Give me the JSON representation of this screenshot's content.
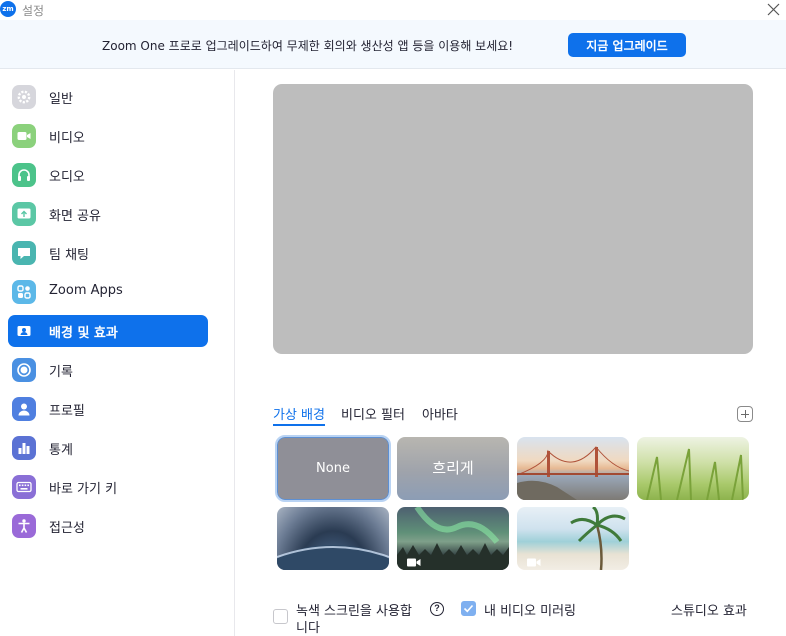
{
  "window": {
    "logo_text": "zm",
    "title": "설정"
  },
  "banner": {
    "text": "Zoom One 프로로 업그레이드하여 무제한 회의와 생산성 앱 등을 이용해 보세요!",
    "button_label": "지금 업그레이드"
  },
  "sidebar": {
    "items": [
      {
        "label": "일반",
        "icon": "gear-icon",
        "color": "#cfcfd6"
      },
      {
        "label": "비디오",
        "icon": "video-camera-icon",
        "color": "#8bd17c"
      },
      {
        "label": "오디오",
        "icon": "headphones-icon",
        "color": "#4cc38a"
      },
      {
        "label": "화면 공유",
        "icon": "screen-share-icon",
        "color": "#5bc7a5"
      },
      {
        "label": "팀 채팅",
        "icon": "chat-bubble-icon",
        "color": "#4ab5b0"
      },
      {
        "label": "Zoom Apps",
        "icon": "apps-icon",
        "color": "#5cb8e8"
      },
      {
        "label": "배경 및 효과",
        "icon": "portrait-icon",
        "color": "#0e71eb"
      },
      {
        "label": "기록",
        "icon": "record-icon",
        "color": "#4a90e2"
      },
      {
        "label": "프로필",
        "icon": "user-icon",
        "color": "#4f7fe0"
      },
      {
        "label": "통계",
        "icon": "bar-chart-icon",
        "color": "#5b72d4"
      },
      {
        "label": "바로 가기 키",
        "icon": "keyboard-icon",
        "color": "#8a6fd6"
      },
      {
        "label": "접근성",
        "icon": "accessibility-icon",
        "color": "#9a6ad8"
      }
    ],
    "active_index": 6
  },
  "tabs": [
    {
      "label": "가상 배경",
      "active": true
    },
    {
      "label": "비디오 필터",
      "active": false
    },
    {
      "label": "아바타",
      "active": false
    }
  ],
  "backgrounds": [
    {
      "label": "None",
      "kind": "none",
      "selected": true
    },
    {
      "label": "흐리게",
      "kind": "blur",
      "selected": false
    },
    {
      "label": "",
      "kind": "bridge",
      "selected": false
    },
    {
      "label": "",
      "kind": "grass",
      "selected": false
    },
    {
      "label": "",
      "kind": "earth",
      "selected": false
    },
    {
      "label": "",
      "kind": "aurora",
      "selected": false,
      "video": true
    },
    {
      "label": "",
      "kind": "beach",
      "selected": false,
      "video": true
    }
  ],
  "options": {
    "green_screen_label_1": "녹색 스크린을 사용합",
    "green_screen_label_2": "니다",
    "green_screen_checked": false,
    "mirror_label": "내 비디오 미러링",
    "mirror_checked": true,
    "help_glyph": "?",
    "studio_effects": "스튜디오 효과"
  },
  "colors": {
    "accent": "#0e71eb",
    "banner_bg": "#f4f9fe",
    "preview_bg": "#bdbdbd"
  }
}
